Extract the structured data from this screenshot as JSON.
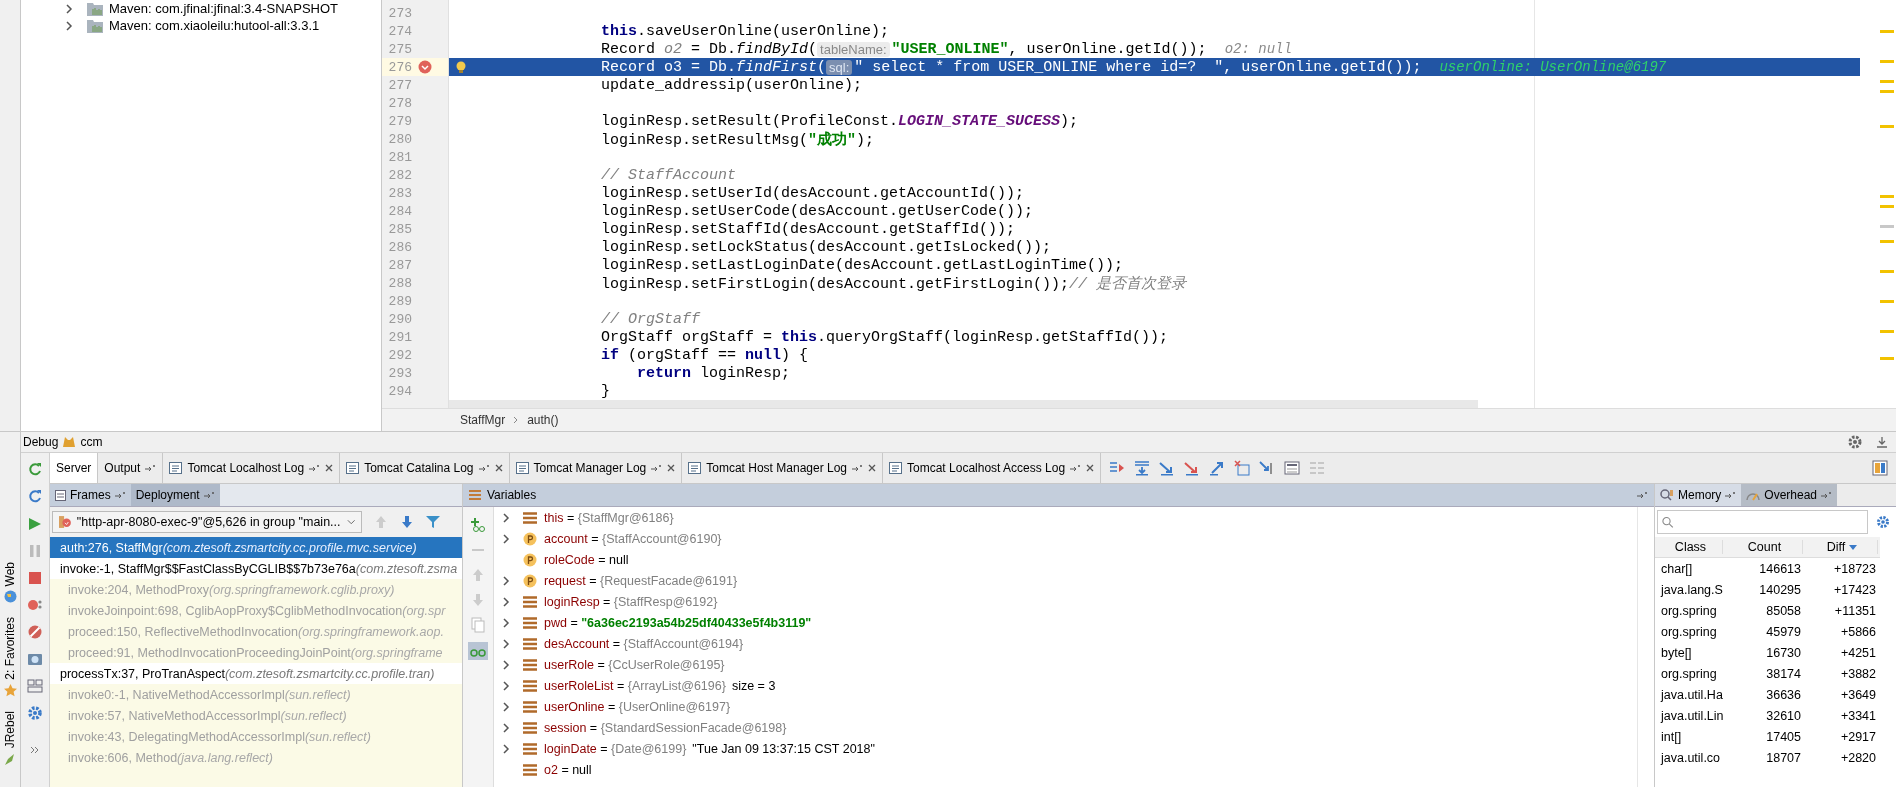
{
  "project_tree": {
    "items": [
      {
        "label": "Maven: com.jfinal:jfinal:3.4-SNAPSHOT",
        "expanded": false
      },
      {
        "label": "Maven: com.xiaoleilu:hutool-all:3.3.1",
        "expanded": false
      }
    ]
  },
  "editor": {
    "lines": [
      {
        "number": "273",
        "current": false,
        "breakpoint": false
      },
      {
        "number": "274",
        "current": false,
        "breakpoint": false,
        "tokens": [
          {
            "kind": "keyword",
            "text": "this"
          },
          {
            "kind": "plain",
            "text": ".saveUserOnline(userOnline);"
          }
        ]
      },
      {
        "number": "275",
        "current": false,
        "breakpoint": false,
        "tokens": [
          {
            "kind": "plain",
            "text": "Record "
          },
          {
            "kind": "unused",
            "text": "o2"
          },
          {
            "kind": "plain",
            "text": " = Db."
          },
          {
            "kind": "italic",
            "text": "findById"
          },
          {
            "kind": "plain",
            "text": "("
          },
          {
            "kind": "hint",
            "text": "tableName:"
          },
          {
            "kind": "string",
            "text": "\"USER_ONLINE\""
          },
          {
            "kind": "plain",
            "text": ", userOnline.getId());"
          },
          {
            "kind": "inline",
            "text": "o2: null"
          }
        ]
      },
      {
        "number": "276",
        "current": true,
        "breakpoint": true,
        "tokens": [
          {
            "kind": "plain",
            "text": "Record o3 = Db."
          },
          {
            "kind": "italic",
            "text": "findFirst"
          },
          {
            "kind": "plain",
            "text": "("
          },
          {
            "kind": "hint",
            "text": "sql:"
          },
          {
            "kind": "string",
            "text": "\" select * from USER_ONLINE where id=?  \""
          },
          {
            "kind": "plain",
            "text": ", userOnline.getId());"
          },
          {
            "kind": "inline",
            "text": "userOnline: UserOnline@6197"
          }
        ]
      },
      {
        "number": "277",
        "current": false,
        "breakpoint": false,
        "tokens": [
          {
            "kind": "plain",
            "text": "update_addressip(userOnline);"
          }
        ]
      },
      {
        "number": "278",
        "current": false,
        "breakpoint": false
      },
      {
        "number": "279",
        "current": false,
        "breakpoint": false,
        "tokens": [
          {
            "kind": "plain",
            "text": "loginResp.setResult(ProfileConst."
          },
          {
            "kind": "constant",
            "text": "LOGIN_STATE_SUCESS"
          },
          {
            "kind": "plain",
            "text": ");"
          }
        ]
      },
      {
        "number": "280",
        "current": false,
        "breakpoint": false,
        "tokens": [
          {
            "kind": "plain",
            "text": "loginResp.setResultMsg("
          },
          {
            "kind": "string",
            "text": "\"成功\""
          },
          {
            "kind": "plain",
            "text": ");"
          }
        ]
      },
      {
        "number": "281",
        "current": false,
        "breakpoint": false
      },
      {
        "number": "282",
        "current": false,
        "breakpoint": false,
        "tokens": [
          {
            "kind": "comment",
            "text": "// StaffAccount"
          }
        ]
      },
      {
        "number": "283",
        "current": false,
        "breakpoint": false,
        "tokens": [
          {
            "kind": "plain",
            "text": "loginResp.setUserId(desAccount.getAccountId());"
          }
        ]
      },
      {
        "number": "284",
        "current": false,
        "breakpoint": false,
        "tokens": [
          {
            "kind": "plain",
            "text": "loginResp.setUserCode(desAccount.getUserCode());"
          }
        ]
      },
      {
        "number": "285",
        "current": false,
        "breakpoint": false,
        "tokens": [
          {
            "kind": "plain",
            "text": "loginResp.setStaffId(desAccount.getStaffId());"
          }
        ]
      },
      {
        "number": "286",
        "current": false,
        "breakpoint": false,
        "tokens": [
          {
            "kind": "plain",
            "text": "loginResp.setLockStatus(desAccount.getIsLocked());"
          }
        ]
      },
      {
        "number": "287",
        "current": false,
        "breakpoint": false,
        "tokens": [
          {
            "kind": "plain",
            "text": "loginResp.setLastLoginDate(desAccount.getLastLoginTime());"
          }
        ]
      },
      {
        "number": "288",
        "current": false,
        "breakpoint": false,
        "tokens": [
          {
            "kind": "plain",
            "text": "loginResp.setFirstLogin(desAccount.getFirstLogin());"
          },
          {
            "kind": "comment",
            "text": "// 是否首次登录"
          }
        ]
      },
      {
        "number": "289",
        "current": false,
        "breakpoint": false
      },
      {
        "number": "290",
        "current": false,
        "breakpoint": false,
        "tokens": [
          {
            "kind": "comment",
            "text": "// OrgStaff"
          }
        ]
      },
      {
        "number": "291",
        "current": false,
        "breakpoint": false,
        "tokens": [
          {
            "kind": "plain",
            "text": "OrgStaff orgStaff = "
          },
          {
            "kind": "keyword",
            "text": "this"
          },
          {
            "kind": "plain",
            "text": ".queryOrgStaff(loginResp.getStaffId());"
          }
        ]
      },
      {
        "number": "292",
        "current": false,
        "breakpoint": false,
        "tokens": [
          {
            "kind": "keyword",
            "text": "if"
          },
          {
            "kind": "plain",
            "text": " (orgStaff == "
          },
          {
            "kind": "keyword",
            "text": "null"
          },
          {
            "kind": "plain",
            "text": ") {"
          }
        ],
        "children": [
          {
            "number": "293",
            "current": false,
            "breakpoint": false,
            "tokens": [
              {
                "kind": "keyword",
                "text": "return"
              },
              {
                "kind": "plain",
                "text": " loginResp;"
              }
            ]
          }
        ]
      },
      {
        "number": "294",
        "current": false,
        "breakpoint": false,
        "tokens": [
          {
            "kind": "plain",
            "text": "}"
          }
        ]
      }
    ],
    "breadcrumb": [
      "StaffMgr",
      "auth()"
    ]
  },
  "side_stripe": [
    "Web",
    "2: Favorites",
    "JRebel"
  ],
  "debug": {
    "title": "Debug",
    "config": "ccm",
    "tabs": [
      {
        "label": "Server",
        "selected": true,
        "kind": "plain",
        "pinned": false,
        "closable": false
      },
      {
        "label": "Output",
        "selected": false,
        "kind": "plain",
        "pinned": true,
        "closable": false
      },
      {
        "label": "Tomcat Localhost Log",
        "selected": false,
        "kind": "log",
        "pinned": true,
        "closable": true
      },
      {
        "label": "Tomcat Catalina Log",
        "selected": false,
        "kind": "log",
        "pinned": true,
        "closable": true
      },
      {
        "label": "Tomcat Manager Log",
        "selected": false,
        "kind": "log",
        "pinned": true,
        "closable": true
      },
      {
        "label": "Tomcat Host Manager Log",
        "selected": false,
        "kind": "log",
        "pinned": true,
        "closable": true
      },
      {
        "label": "Tomcat Localhost Access Log",
        "selected": false,
        "kind": "log",
        "pinned": true,
        "closable": true
      }
    ]
  },
  "frames_panel": {
    "tabs": [
      {
        "label": "Frames",
        "selected": true
      },
      {
        "label": "Deployment",
        "selected": false
      }
    ],
    "thread": "\"http-apr-8080-exec-9\"@5,626 in group \"main...",
    "frames": [
      {
        "method": "auth:276, StaffMgr",
        "package": "(com.ztesoft.zsmartcity.cc.profile.mvc.service)",
        "selected": true,
        "library": false
      },
      {
        "method": "invoke:-1, StaffMgr$$FastClassByCGLIB$$7b73e76a",
        "package": "(com.ztesoft.zsma",
        "selected": false,
        "library": false
      },
      {
        "method": "invoke:204, MethodProxy",
        "package": "(org.springframework.cglib.proxy)",
        "selected": false,
        "library": true
      },
      {
        "method": "invokeJoinpoint:698, CglibAopProxy$CglibMethodInvocation",
        "package": "(org.spr",
        "selected": false,
        "library": true
      },
      {
        "method": "proceed:150, ReflectiveMethodInvocation",
        "package": "(org.springframework.aop.",
        "selected": false,
        "library": true
      },
      {
        "method": "proceed:91, MethodInvocationProceedingJoinPoint",
        "package": "(org.springframe",
        "selected": false,
        "library": true
      },
      {
        "method": "processTx:37, ProTranAspect",
        "package": "(com.ztesoft.zsmartcity.cc.profile.tran)",
        "selected": false,
        "library": false
      },
      {
        "method": "invoke0:-1, NativeMethodAccessorImpl",
        "package": "(sun.reflect)",
        "selected": false,
        "library": true
      },
      {
        "method": "invoke:57, NativeMethodAccessorImpl",
        "package": "(sun.reflect)",
        "selected": false,
        "library": true
      },
      {
        "method": "invoke:43, DelegatingMethodAccessorImpl",
        "package": "(sun.reflect)",
        "selected": false,
        "library": true
      },
      {
        "method": "invoke:606, Method",
        "package": "(java.lang.reflect)",
        "selected": false,
        "library": true
      }
    ]
  },
  "variables_panel": {
    "title": "Variables",
    "variables": [
      {
        "kind": "field",
        "name": "this",
        "operator": "=",
        "value": "{StaffMgr@6186}",
        "reference": true,
        "string_literal": false,
        "expandable": true
      },
      {
        "kind": "param",
        "name": "account",
        "operator": "=",
        "value": "{StaffAccount@6190}",
        "reference": true,
        "string_literal": false,
        "expandable": true
      },
      {
        "kind": "param",
        "name": "roleCode",
        "operator": "=",
        "value": "null",
        "reference": false,
        "string_literal": false,
        "expandable": false
      },
      {
        "kind": "param",
        "name": "request",
        "operator": "=",
        "value": "{RequestFacade@6191}",
        "reference": true,
        "string_literal": false,
        "expandable": true
      },
      {
        "kind": "field",
        "name": "loginResp",
        "operator": "=",
        "value": "{StaffResp@6192}",
        "reference": true,
        "string_literal": false,
        "expandable": true
      },
      {
        "kind": "field",
        "name": "pwd",
        "operator": "=",
        "value": "\"6a36ec2193a54b25df40433e5f4b3119\"",
        "reference": false,
        "string_literal": true,
        "expandable": true
      },
      {
        "kind": "field",
        "name": "desAccount",
        "operator": "=",
        "value": "{StaffAccount@6194}",
        "reference": true,
        "string_literal": false,
        "expandable": true
      },
      {
        "kind": "field",
        "name": "userRole",
        "operator": "=",
        "value": "{CcUserRole@6195}",
        "reference": true,
        "string_literal": false,
        "expandable": true
      },
      {
        "kind": "field",
        "name": "userRoleList",
        "operator": "=",
        "value": "{ArrayList@6196}",
        "reference": true,
        "string_literal": false,
        "extra": "size = 3",
        "expandable": true
      },
      {
        "kind": "field",
        "name": "userOnline",
        "operator": "=",
        "value": "{UserOnline@6197}",
        "reference": true,
        "string_literal": false,
        "expandable": true
      },
      {
        "kind": "field",
        "name": "session",
        "operator": "=",
        "value": "{StandardSessionFacade@6198}",
        "reference": true,
        "string_literal": false,
        "expandable": true
      },
      {
        "kind": "field",
        "name": "loginDate",
        "operator": "=",
        "value": "{Date@6199}",
        "reference": true,
        "string_literal": false,
        "extra": "\"Tue Jan 09 13:37:15 CST 2018\"",
        "expandable": true
      },
      {
        "kind": "field",
        "name": "o2",
        "operator": "=",
        "value": "null",
        "reference": false,
        "string_literal": false,
        "expandable": false
      }
    ]
  },
  "memory_panel": {
    "tabs": [
      {
        "label": "Memory",
        "selected": true
      },
      {
        "label": "Overhead",
        "selected": false
      }
    ],
    "columns": [
      "Class",
      "Count",
      "Diff"
    ],
    "rows": [
      [
        "char[]",
        "146613",
        "+18723"
      ],
      [
        "java.lang.S",
        "140295",
        "+17423"
      ],
      [
        "org.spring",
        "85058",
        "+11351"
      ],
      [
        "org.spring",
        "45979",
        "+5866"
      ],
      [
        "byte[]",
        "16730",
        "+4251"
      ],
      [
        "org.spring",
        "38174",
        "+3882"
      ],
      [
        "java.util.Ha",
        "36636",
        "+3649"
      ],
      [
        "java.util.Lin",
        "32610",
        "+3341"
      ],
      [
        "int[]",
        "17405",
        "+2917"
      ],
      [
        "java.util.co",
        "18707",
        "+2820"
      ]
    ]
  }
}
